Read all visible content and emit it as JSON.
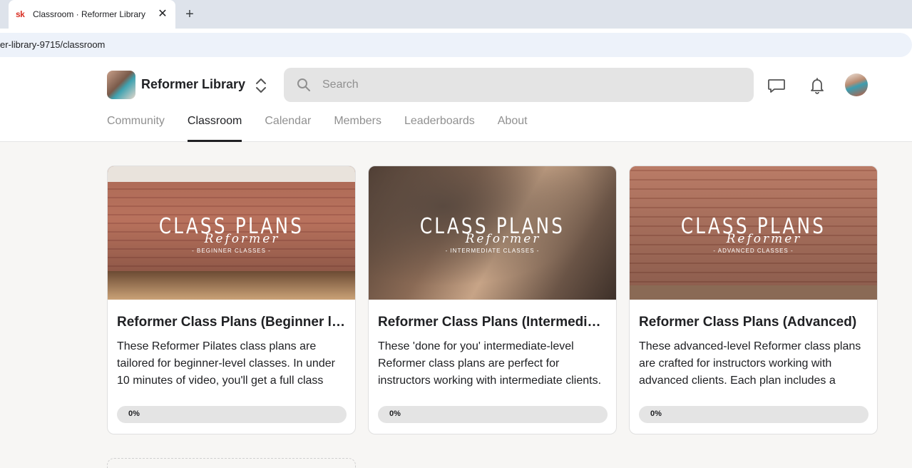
{
  "browser": {
    "tab_title": "Classroom · Reformer Library",
    "favicon_text": "sk",
    "close_glyph": "✕",
    "new_tab_glyph": "+",
    "address": "er-library-9715/classroom"
  },
  "header": {
    "group_name": "Reformer Library",
    "search_placeholder": "Search",
    "nav": [
      "Community",
      "Classroom",
      "Calendar",
      "Members",
      "Leaderboards",
      "About"
    ],
    "active_nav": "Classroom"
  },
  "courses": [
    {
      "cover_title": "CLASS PLANS",
      "cover_script": "Reformer",
      "cover_sub": "- BEGINNER CLASSES -",
      "title": "Reformer Class Plans (Beginner level)",
      "description": "These Reformer Pilates class plans are tailored for beginner-level classes. In under 10 minutes of video, you'll get a full class",
      "progress": 0,
      "progress_label": "0%"
    },
    {
      "cover_title": "CLASS PLANS",
      "cover_script": "Reformer",
      "cover_sub": "- INTERMEDIATE CLASSES -",
      "title": "Reformer Class Plans (Intermediate level)",
      "description": "These 'done for you' intermediate-level Reformer class plans are perfect for instructors working with intermediate clients.",
      "progress": 0,
      "progress_label": "0%"
    },
    {
      "cover_title": "CLASS PLANS",
      "cover_script": "Reformer",
      "cover_sub": "- ADVANCED CLASSES -",
      "title": "Reformer Class Plans (Advanced)",
      "description": "These advanced-level Reformer class plans are crafted for instructors working with advanced clients. Each plan includes a",
      "progress": 0,
      "progress_label": "0%"
    }
  ]
}
